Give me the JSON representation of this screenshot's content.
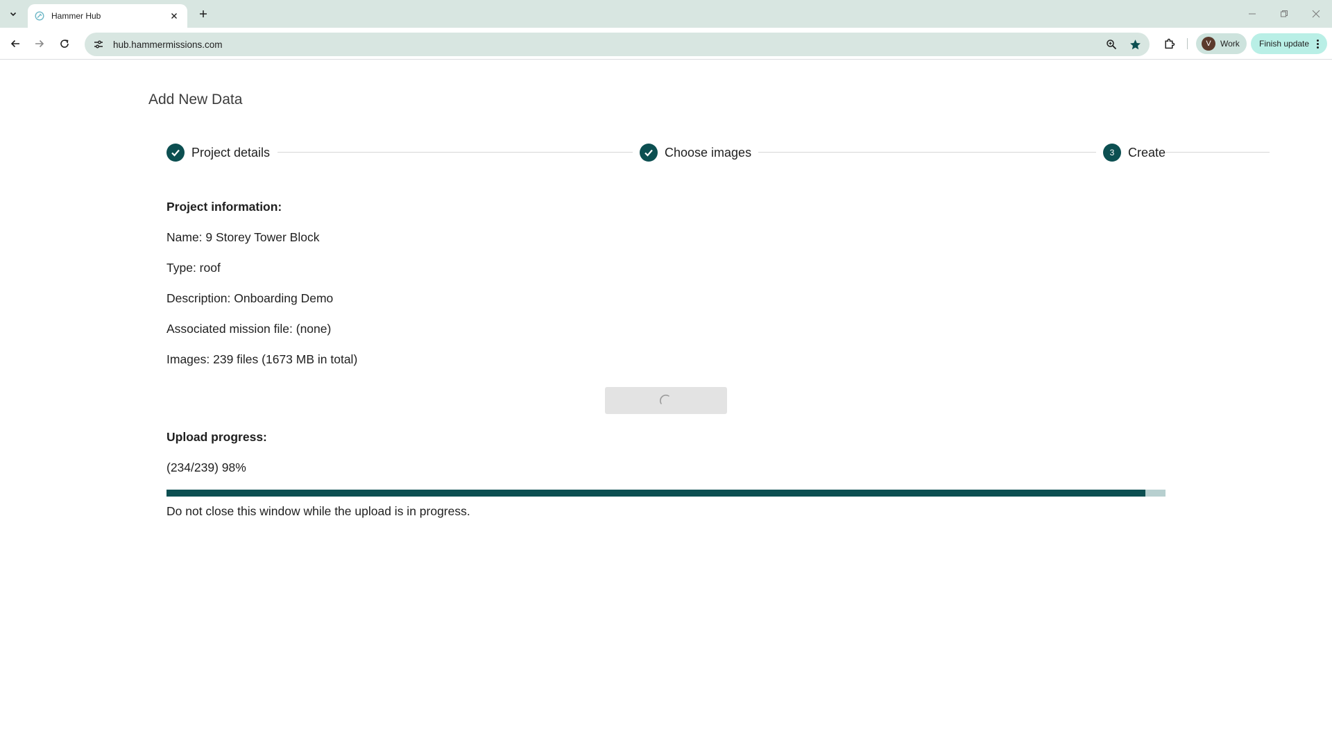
{
  "browser": {
    "tab_title": "Hammer Hub",
    "url": "hub.hammermissions.com",
    "profile_initial": "V",
    "profile_label": "Work",
    "update_label": "Finish update"
  },
  "page": {
    "title": "Add New Data",
    "steps": [
      {
        "label": "Project details",
        "status": "complete"
      },
      {
        "label": "Choose images",
        "status": "complete"
      },
      {
        "number": "3",
        "label": "Create",
        "status": "active"
      }
    ],
    "project_info_heading": "Project information:",
    "name_line": "Name: 9 Storey Tower Block",
    "type_line": "Type: roof",
    "description_line": "Description: Onboarding Demo",
    "mission_line": "Associated mission file: (none)",
    "images_line": "Images: 239 files (1673 MB in total)",
    "upload_heading": "Upload progress:",
    "upload_status": "(234/239) 98%",
    "upload_fraction": 0.98,
    "warning": "Do not close this window while the upload is in progress."
  },
  "colors": {
    "accent": "#0c4f51",
    "progress_track": "#b7cfcf",
    "chrome_tint": "#d8e6e1"
  }
}
